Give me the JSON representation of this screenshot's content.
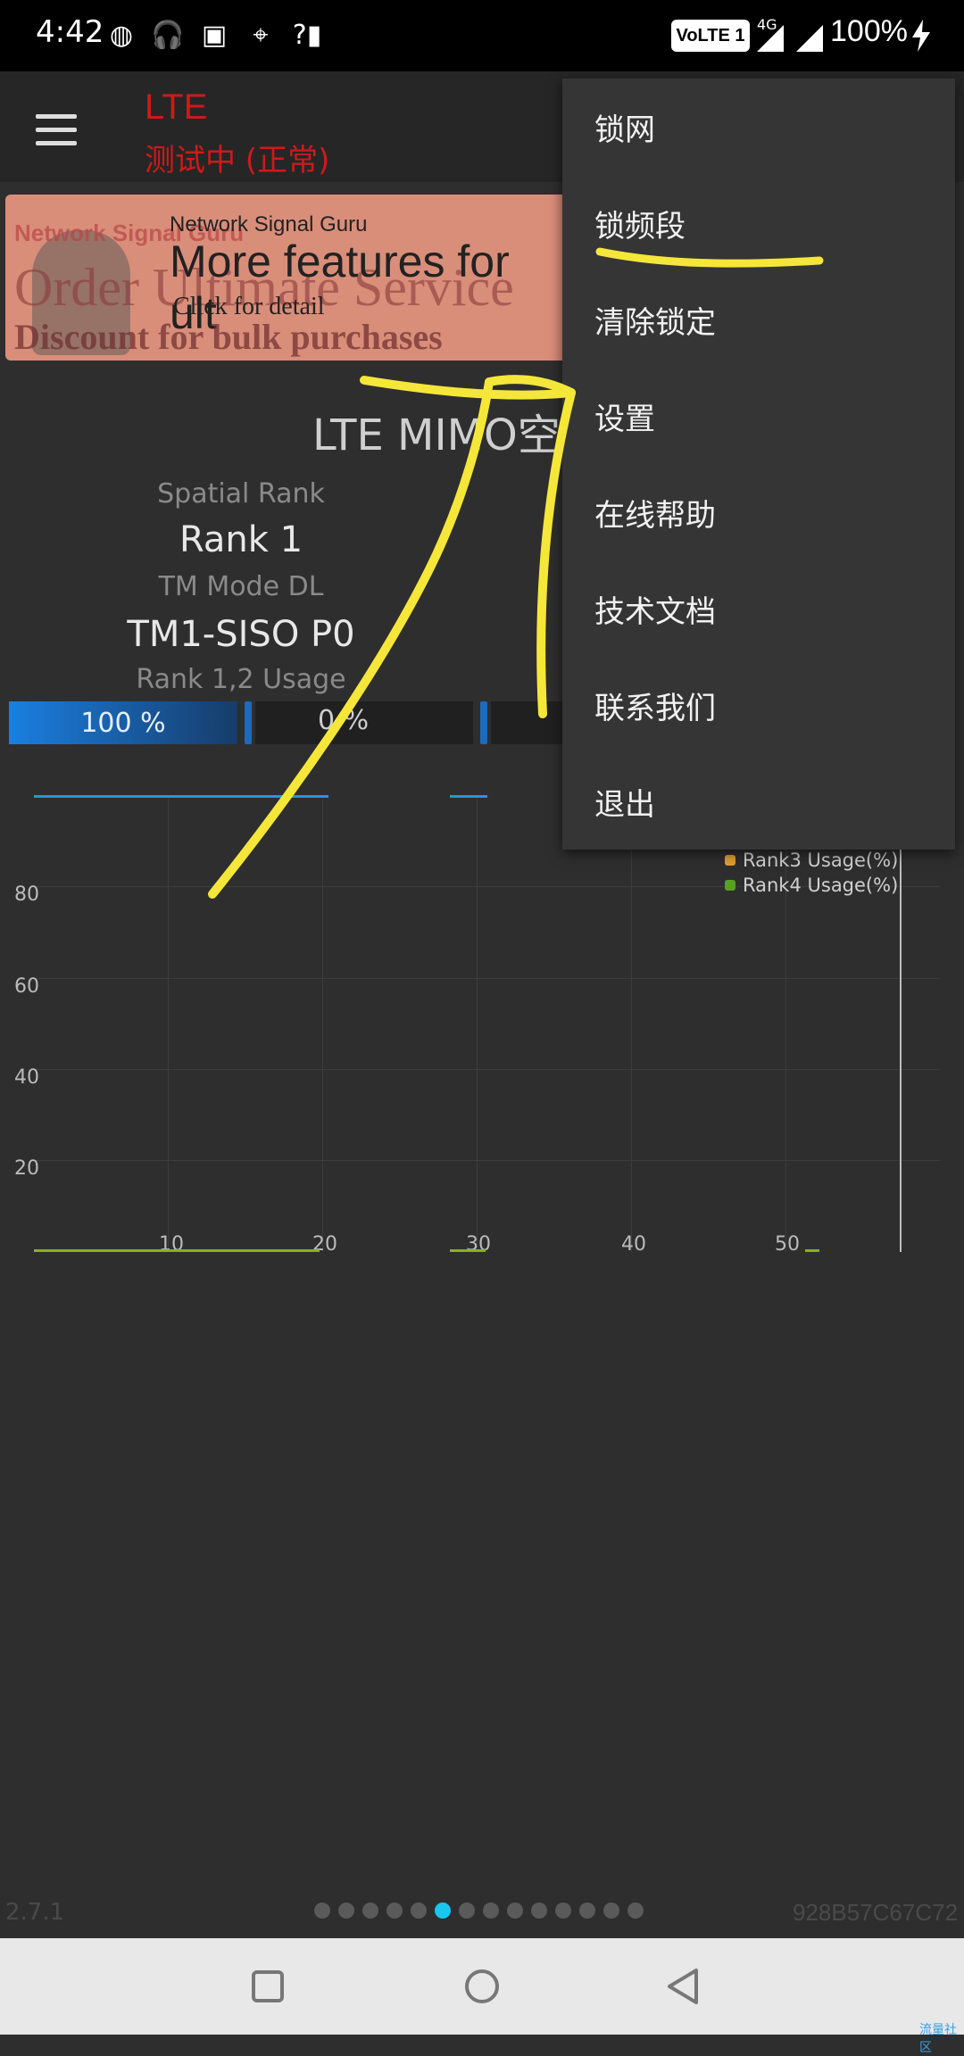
{
  "status_bar": {
    "time": "4:42",
    "volte": "VoLTE 1",
    "network": "4G",
    "battery": "100%"
  },
  "app_bar": {
    "title": "LTE",
    "status": "测试中 (正常)"
  },
  "banner": {
    "brand": "Network Signal Guru",
    "headline": "More features for ult",
    "detail": "Click for detail",
    "bg_line1": "Network Signal Guru",
    "bg_line2": "Order Ultimate Service",
    "bg_line3": "Discount for bulk purchases"
  },
  "panel": {
    "title": "LTE MIMO空",
    "spatial_rank_label": "Spatial Rank",
    "spatial_rank_value": "Rank 1",
    "tm_mode_label": "TM Mode DL",
    "tm_mode_value": "TM1-SISO P0",
    "usage_label": "Rank 1,2 Usage",
    "bar1_value": "100 %",
    "bar2_value": "0 %"
  },
  "chart_data": {
    "type": "line",
    "y_ticks": [
      "80",
      "60",
      "40",
      "20"
    ],
    "x_ticks": [
      "10",
      "20",
      "30",
      "40",
      "50"
    ],
    "legend": [
      {
        "name": "Rank3 Usage(%)",
        "color": "#e0a030"
      },
      {
        "name": "Rank4 Usage(%)",
        "color": "#5aa020"
      }
    ]
  },
  "menu": {
    "items": [
      "锁网",
      "锁频段",
      "清除锁定",
      "设置",
      "在线帮助",
      "技术文档",
      "联系我们",
      "退出"
    ]
  },
  "footer": {
    "version": "2.7.1",
    "device_id": "928B57C67C72",
    "page_count": 14,
    "active_page": 6,
    "watermark": "流量社区"
  },
  "colors": {
    "accent_red": "#d01919",
    "bar_blue": "#1a7fe0",
    "annotation_yellow": "#f5e63a",
    "active_dot": "#19c6ef"
  }
}
